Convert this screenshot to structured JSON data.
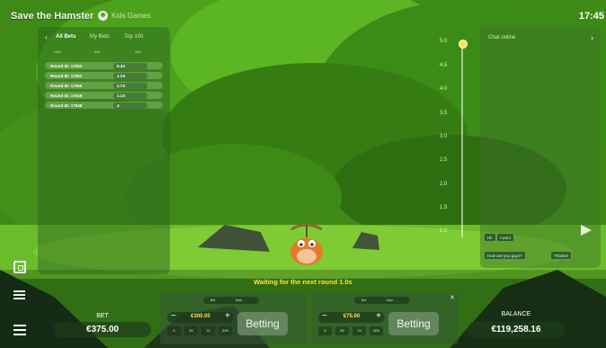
{
  "header": {
    "title": "Save the Hamster",
    "player": "Kids Games",
    "time": "17:45"
  },
  "bets_panel": {
    "tabs": [
      "All Bets",
      "My Bets",
      "Top 100"
    ],
    "columns": [
      "User",
      "Bet",
      "Win"
    ],
    "rows": [
      {
        "round": "Round ID: 17052",
        "mult": "5.3X"
      },
      {
        "round": "Round ID: 17051",
        "mult": "1.1X"
      },
      {
        "round": "Round ID: 17050",
        "mult": "2.7X"
      },
      {
        "round": "Round ID: 17049",
        "mult": "1.1X"
      },
      {
        "round": "Round ID: 17048",
        "mult": "4"
      }
    ]
  },
  "scale": {
    "ticks": [
      "5.0",
      "4.5",
      "4.0",
      "3.5",
      "3.0",
      "2.5",
      "2.0",
      "1.5",
      "1.0"
    ]
  },
  "chat": {
    "header": "Chat online",
    "quick_messages": [
      "Hi!",
      "I won!",
      "How are you guys?",
      "Thanks!"
    ]
  },
  "status": "Waiting for the next round 1.0s",
  "bet": {
    "label": "BET",
    "amount": "€375.00"
  },
  "balance": {
    "label": "BALANCE",
    "amount": "€119,258.16"
  },
  "bet_boxes": [
    {
      "tabs": [
        "Bet",
        "Auto"
      ],
      "stake": "€300.00",
      "quick": [
        "5",
        "30",
        "72",
        "300"
      ],
      "button": "Betting"
    },
    {
      "tabs": [
        "Bet",
        "Auto"
      ],
      "stake": "€75.00",
      "quick": [
        "5",
        "30",
        "72",
        "300"
      ],
      "button": "Betting"
    }
  ],
  "icons": [
    "screen-icon",
    "list-icon",
    "menu-icon",
    "send-icon",
    "back-arrow-icon",
    "forward-arrow-icon",
    "close-icon"
  ]
}
